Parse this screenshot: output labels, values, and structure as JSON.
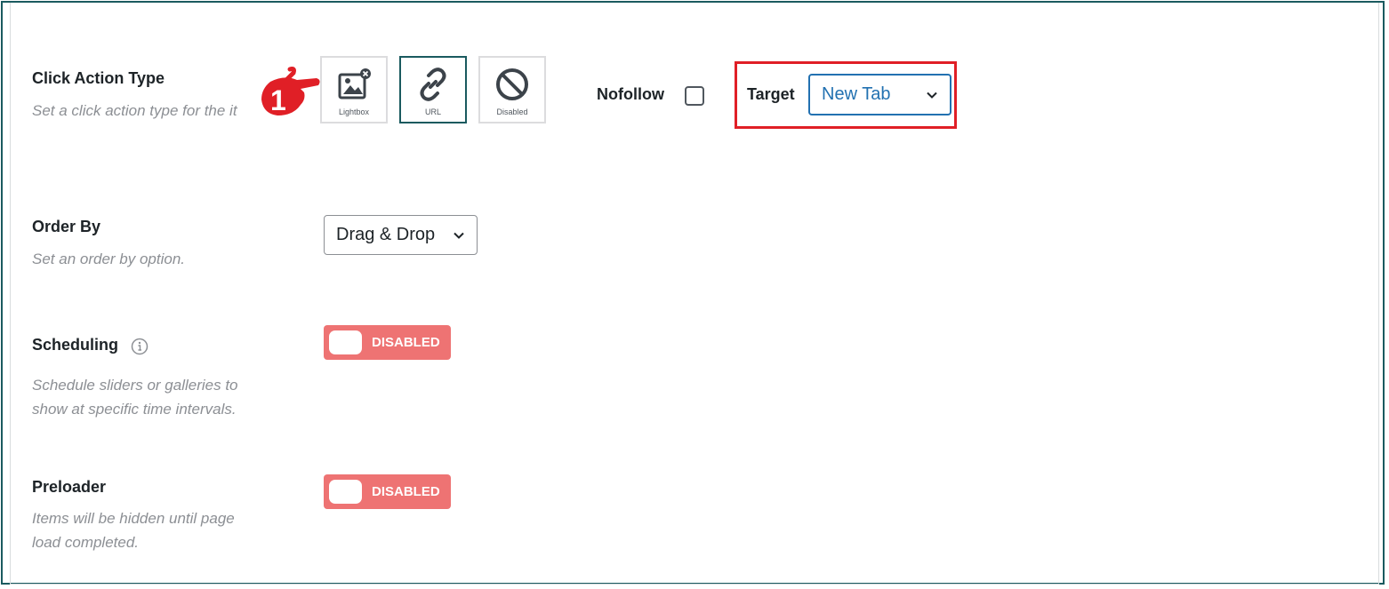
{
  "click_action": {
    "label": "Click Action Type",
    "description": "Set a click action type for the it",
    "pointer_number": "1",
    "options": [
      {
        "label": "Lightbox",
        "icon": "lightbox-icon",
        "selected": false
      },
      {
        "label": "URL",
        "icon": "link-icon",
        "selected": true
      },
      {
        "label": "Disabled",
        "icon": "disabled-icon",
        "selected": false
      }
    ],
    "nofollow_label": "Nofollow",
    "nofollow_checked": false,
    "target_label": "Target",
    "target_value": "New Tab"
  },
  "order_by": {
    "label": "Order By",
    "description": "Set an order by option.",
    "value": "Drag & Drop"
  },
  "scheduling": {
    "label": "Scheduling",
    "description_line1": "Schedule sliders or galleries to",
    "description_line2": "show at specific time intervals.",
    "toggle_text": "DISABLED"
  },
  "preloader": {
    "label": "Preloader",
    "description_line1": "Items will be hidden until page",
    "description_line2": "load completed.",
    "toggle_text": "DISABLED"
  },
  "colors": {
    "accent": "#1a5a5f",
    "highlight": "#e01f26",
    "toggle_off": "#ee7373",
    "select_focus": "#2271b1"
  }
}
